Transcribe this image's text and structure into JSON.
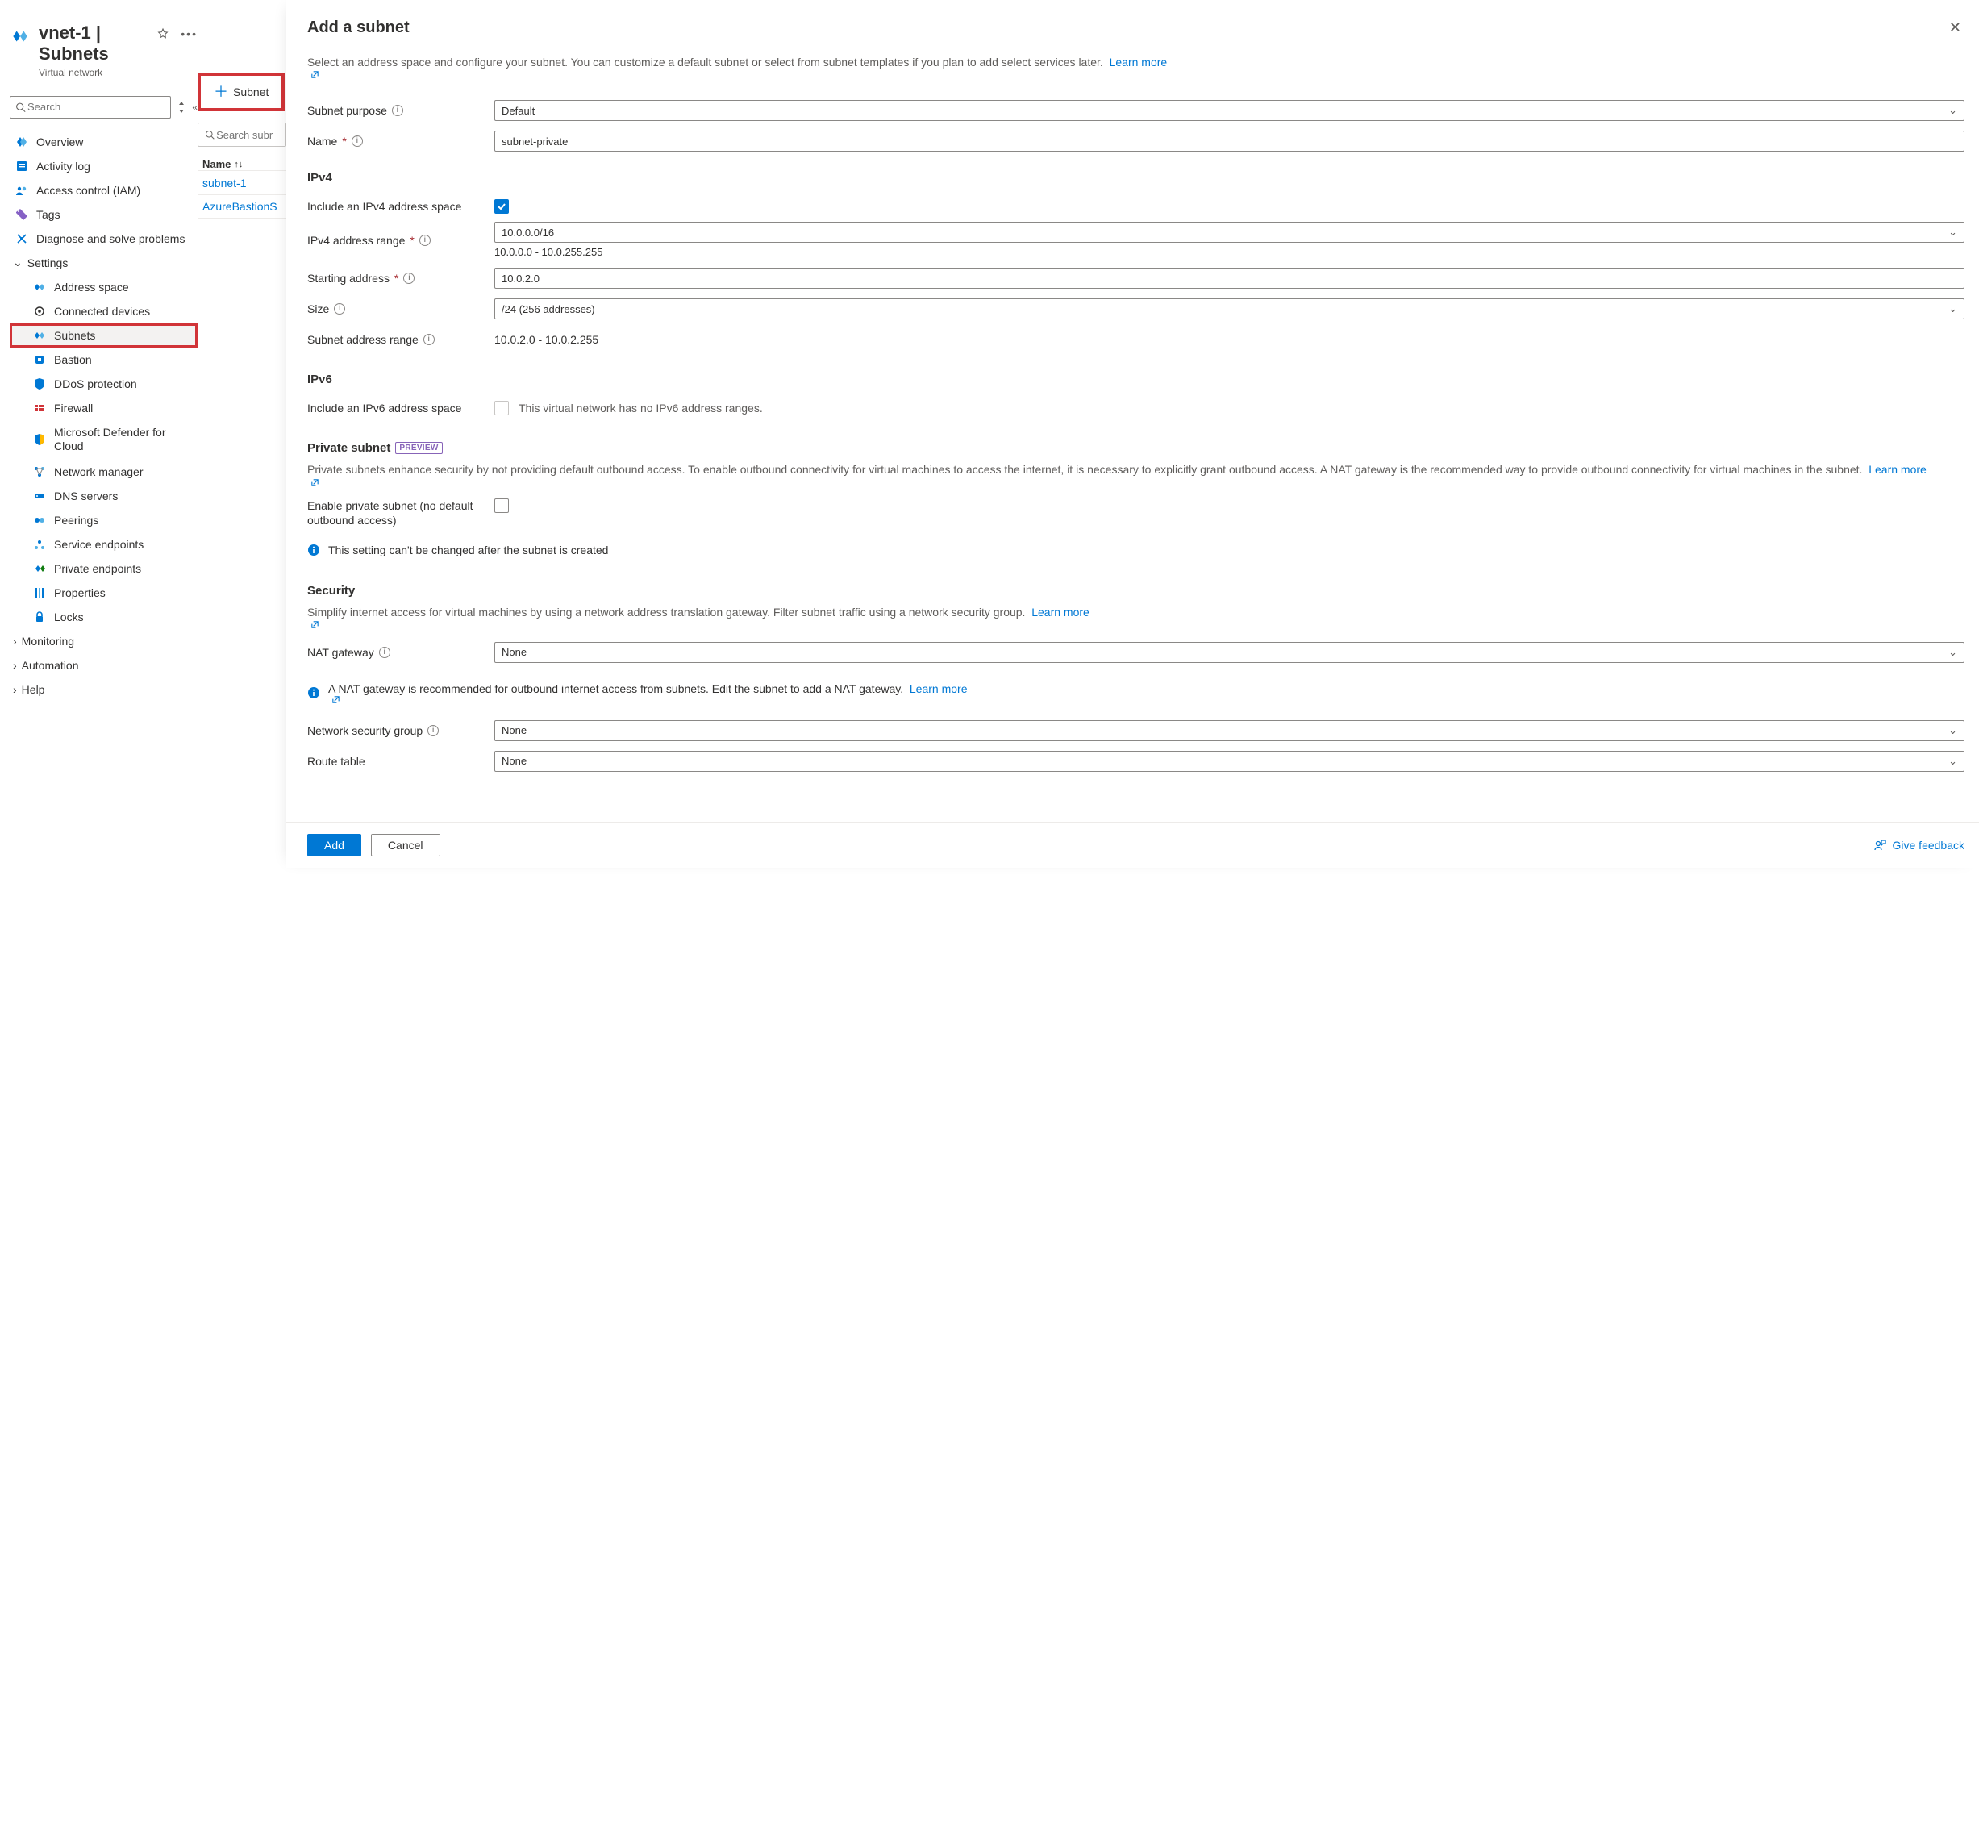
{
  "header": {
    "title": "vnet-1 | Subnets",
    "subtitle": "Virtual network"
  },
  "search": {
    "placeholder": "Search"
  },
  "nav": {
    "items": [
      {
        "label": "Overview"
      },
      {
        "label": "Activity log"
      },
      {
        "label": "Access control (IAM)"
      },
      {
        "label": "Tags"
      },
      {
        "label": "Diagnose and solve problems"
      }
    ],
    "settings_label": "Settings",
    "settings_children": [
      {
        "label": "Address space"
      },
      {
        "label": "Connected devices"
      },
      {
        "label": "Subnets"
      },
      {
        "label": "Bastion"
      },
      {
        "label": "DDoS protection"
      },
      {
        "label": "Firewall"
      },
      {
        "label": "Microsoft Defender for Cloud"
      },
      {
        "label": "Network manager"
      },
      {
        "label": "DNS servers"
      },
      {
        "label": "Peerings"
      },
      {
        "label": "Service endpoints"
      },
      {
        "label": "Private endpoints"
      },
      {
        "label": "Properties"
      },
      {
        "label": "Locks"
      }
    ],
    "collapsed": [
      {
        "label": "Monitoring"
      },
      {
        "label": "Automation"
      },
      {
        "label": "Help"
      }
    ]
  },
  "mid": {
    "add_subnet": "Subnet",
    "search_placeholder": "Search subr",
    "col_name": "Name",
    "rows": [
      "subnet-1",
      "AzureBastionS"
    ]
  },
  "panel": {
    "title": "Add a subnet",
    "intro": "Select an address space and configure your subnet. You can customize a default subnet or select from subnet templates if you plan to add select services later.",
    "learn_more": "Learn more",
    "purpose_label": "Subnet purpose",
    "purpose_value": "Default",
    "name_label": "Name",
    "name_value": "subnet-private",
    "ipv4_h": "IPv4",
    "include_ipv4": "Include an IPv4 address space",
    "ipv4_range_label": "IPv4 address range",
    "ipv4_range_value": "10.0.0.0/16",
    "ipv4_range_helper": "10.0.0.0 - 10.0.255.255",
    "start_label": "Starting address",
    "start_value": "10.0.2.0",
    "size_label": "Size",
    "size_value": "/24 (256 addresses)",
    "subnet_range_label": "Subnet address range",
    "subnet_range_value": "10.0.2.0 - 10.0.2.255",
    "ipv6_h": "IPv6",
    "include_ipv6": "Include an IPv6 address space",
    "ipv6_msg": "This virtual network has no IPv6 address ranges.",
    "private_h": "Private subnet",
    "preview": "PREVIEW",
    "private_desc": "Private subnets enhance security by not providing default outbound access. To enable outbound connectivity for virtual machines to access the internet, it is necessary to explicitly grant outbound access. A NAT gateway is the recommended way to provide outbound connectivity for virtual machines in the subnet.",
    "enable_private": "Enable private subnet (no default outbound access)",
    "private_note": "This setting can't be changed after the subnet is created",
    "security_h": "Security",
    "security_desc": "Simplify internet access for virtual machines by using a network address translation gateway. Filter subnet traffic using a network security group.",
    "nat_label": "NAT gateway",
    "none": "None",
    "nat_note": "A NAT gateway is recommended for outbound internet access from subnets. Edit the subnet to add a NAT gateway.",
    "nsg_label": "Network security group",
    "rt_label": "Route table",
    "add_btn": "Add",
    "cancel_btn": "Cancel",
    "feedback": "Give feedback"
  }
}
